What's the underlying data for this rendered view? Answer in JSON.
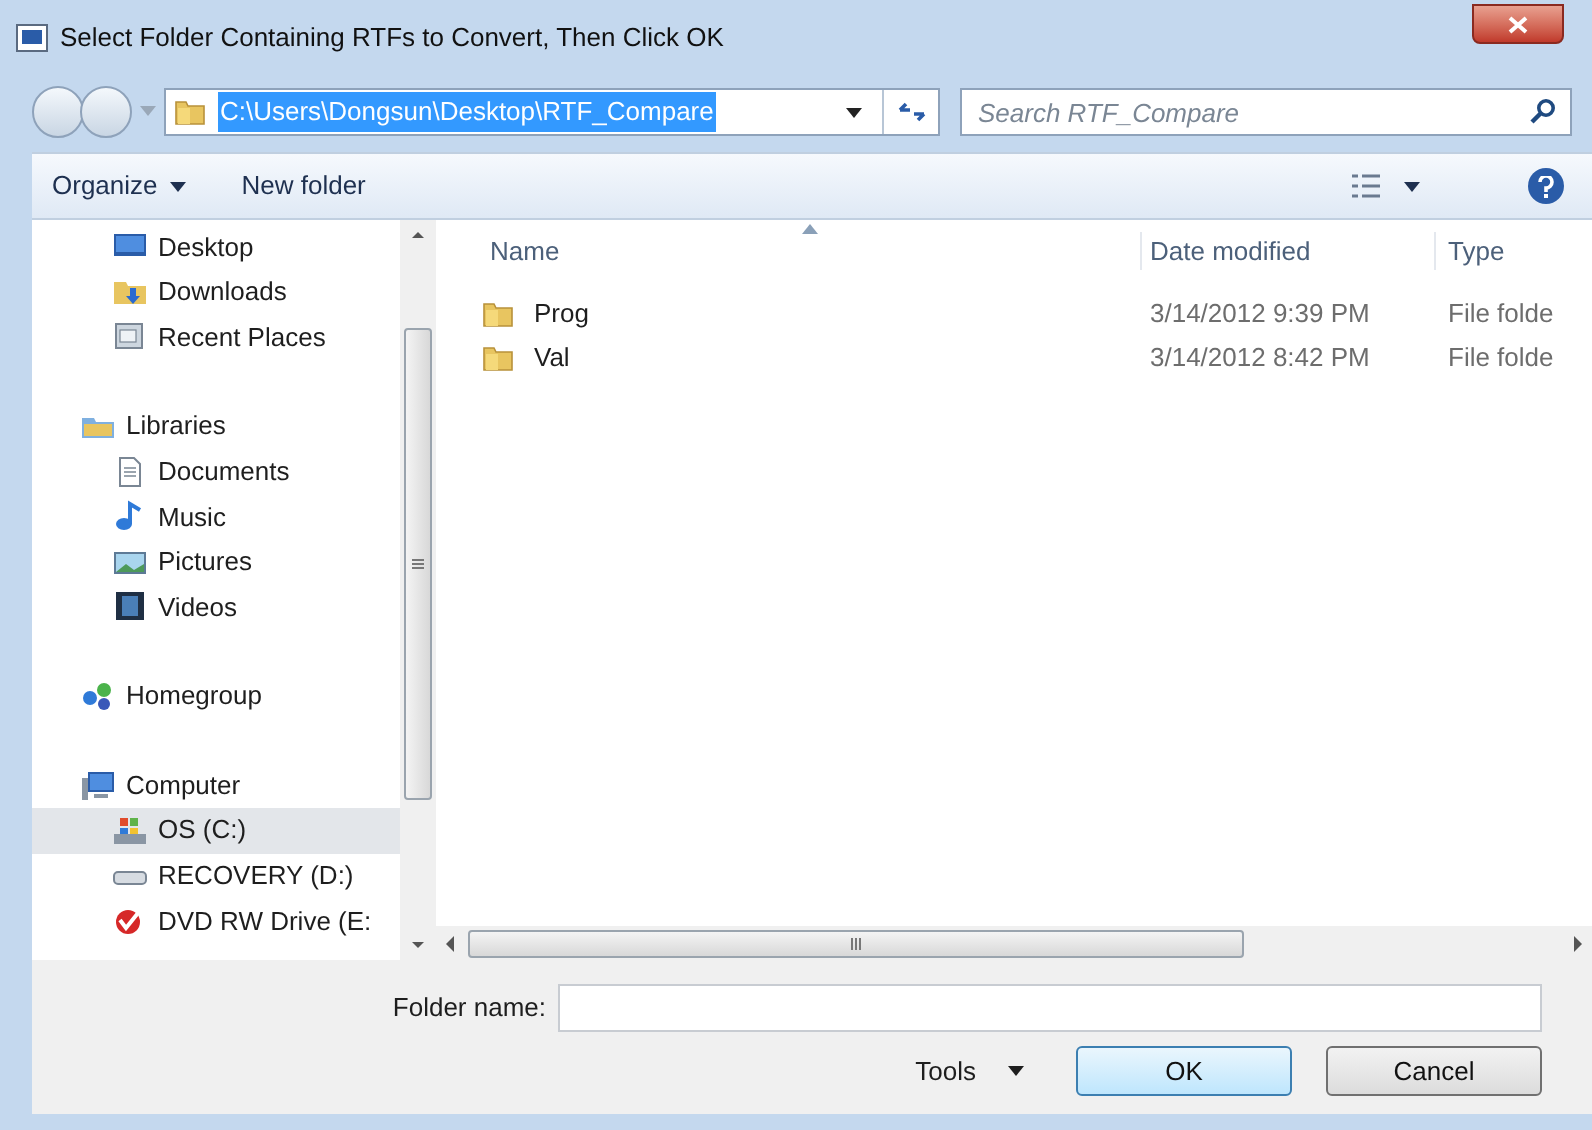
{
  "window": {
    "title": "Select Folder Containing RTFs to Convert, Then Click OK"
  },
  "address": {
    "value": "C:\\Users\\Dongsun\\Desktop\\RTF_Compare"
  },
  "search": {
    "placeholder": "Search RTF_Compare"
  },
  "toolbar": {
    "organize": "Organize",
    "new_folder": "New folder"
  },
  "nav_groups": [
    {
      "children": [
        {
          "label": "Desktop",
          "kind": "desktop",
          "selected": false
        },
        {
          "label": "Downloads",
          "kind": "downloads",
          "selected": false
        },
        {
          "label": "Recent Places",
          "kind": "recent",
          "selected": false
        }
      ]
    },
    {
      "label": "Libraries",
      "kind": "libraries",
      "selected": false,
      "children": [
        {
          "label": "Documents",
          "kind": "documents",
          "selected": false
        },
        {
          "label": "Music",
          "kind": "music",
          "selected": false
        },
        {
          "label": "Pictures",
          "kind": "pictures",
          "selected": false
        },
        {
          "label": "Videos",
          "kind": "videos",
          "selected": false
        }
      ]
    },
    {
      "label": "Homegroup",
      "kind": "homegroup",
      "selected": false
    },
    {
      "label": "Computer",
      "kind": "computer",
      "selected": false,
      "children": [
        {
          "label": "OS (C:)",
          "kind": "os-drive",
          "selected": true
        },
        {
          "label": "RECOVERY (D:)",
          "kind": "drive",
          "selected": false
        },
        {
          "label": "DVD RW Drive (E:",
          "kind": "dvd",
          "selected": false
        }
      ]
    }
  ],
  "table": {
    "columns": [
      "Name",
      "Date modified",
      "Type"
    ],
    "rows": [
      {
        "name": "Prog",
        "date_modified": "3/14/2012 9:39 PM",
        "type": "File folde"
      },
      {
        "name": "Val",
        "date_modified": "3/14/2012 8:42 PM",
        "type": "File folde"
      }
    ]
  },
  "folder_name": {
    "label": "Folder name:"
  },
  "buttons": {
    "tools": "Tools",
    "ok": "OK",
    "cancel": "Cancel"
  }
}
